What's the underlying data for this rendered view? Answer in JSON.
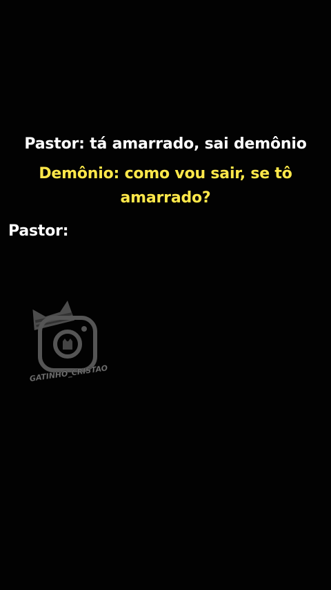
{
  "dialogue": {
    "line_1": "Pastor: tá amarrado, sai demônio",
    "line_2": "Demônio: como vou sair, se tô amarrado?",
    "line_3": "Pastor:"
  },
  "watermark": {
    "handle": "GATINHO_CRISTAO",
    "icon": "instagram-cat-logo-icon"
  },
  "colors": {
    "background": "#020202",
    "text_white": "#ffffff",
    "text_yellow": "#ffe84a"
  }
}
